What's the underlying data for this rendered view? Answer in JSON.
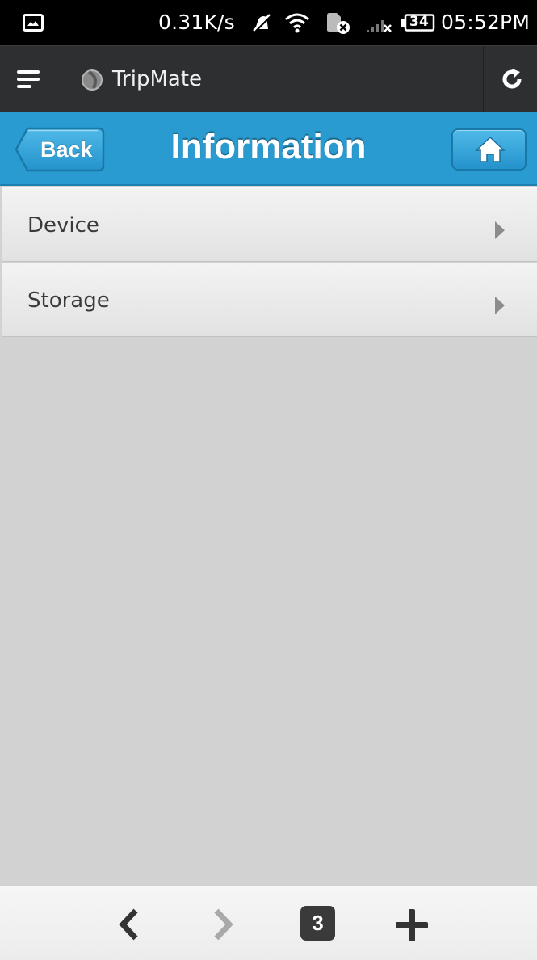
{
  "status_bar": {
    "net_speed": "0.31K/s",
    "battery_level": "34",
    "time": "05:52PM",
    "icons": [
      "image-notification-icon",
      "muted-bell-icon",
      "wifi-icon",
      "sim-error-icon",
      "cell-signal-icon",
      "battery-icon"
    ]
  },
  "browser": {
    "site_title": "TripMate",
    "icons": [
      "menu-icon",
      "site-favicon-icon",
      "refresh-icon"
    ]
  },
  "header": {
    "back_label": "Back",
    "title": "Information",
    "icons": [
      "home-icon"
    ]
  },
  "list": {
    "items": [
      {
        "label": "Device"
      },
      {
        "label": "Storage"
      }
    ],
    "icons": [
      "chevron-right-icon"
    ]
  },
  "bottom_bar": {
    "tab_count": "3",
    "icons": [
      "back-arrow-icon",
      "forward-arrow-icon",
      "add-tab-icon"
    ]
  },
  "colors": {
    "header_blue": "#2a9bd0",
    "toolbar_dark": "#2e2f31",
    "content_gray": "#d2d2d2"
  }
}
